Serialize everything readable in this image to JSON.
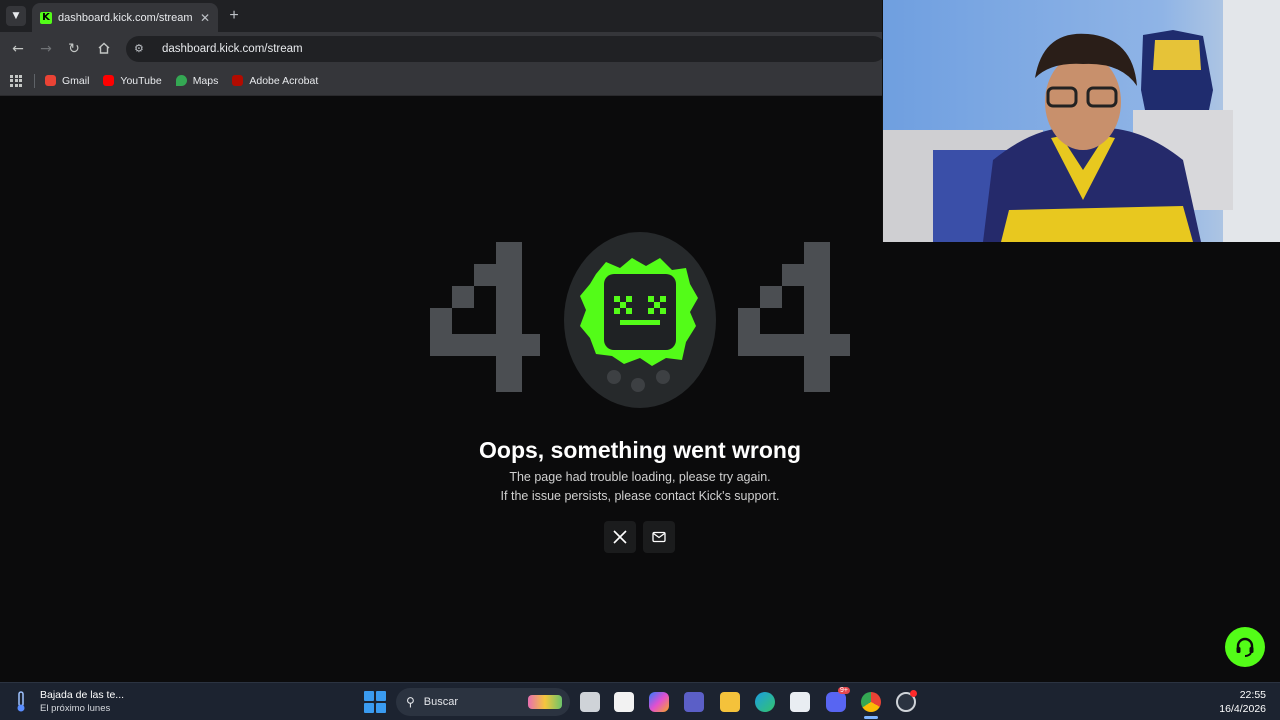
{
  "browser": {
    "tab": {
      "title": "dashboard.kick.com/stream",
      "favicon": "kick-logo"
    },
    "address": "dashboard.kick.com/stream",
    "bookmarks": [
      {
        "label": "Gmail",
        "color": "#ea4335"
      },
      {
        "label": "YouTube",
        "color": "#ff0000"
      },
      {
        "label": "Maps",
        "color": "#34a853"
      },
      {
        "label": "Adobe Acrobat",
        "color": "#b30b00"
      }
    ]
  },
  "error": {
    "code_left": "4",
    "code_right": "4",
    "title": "Oops, something went wrong",
    "line1": "The page had trouble loading, please try again.",
    "line2": "If the issue persists, please contact Kick's support."
  },
  "social": {
    "x_icon": "x-logo-icon",
    "mail_icon": "mail-icon"
  },
  "colors": {
    "brand": "#53fc18",
    "background": "#0b0b0c",
    "digit": "#4b4e52"
  },
  "taskbar": {
    "weather_title": "Bajada de las te...",
    "weather_sub": "El próximo lunes",
    "search_label": "Buscar",
    "time": "22:55",
    "date": "16/4/2026",
    "discord_badge": "9+"
  }
}
